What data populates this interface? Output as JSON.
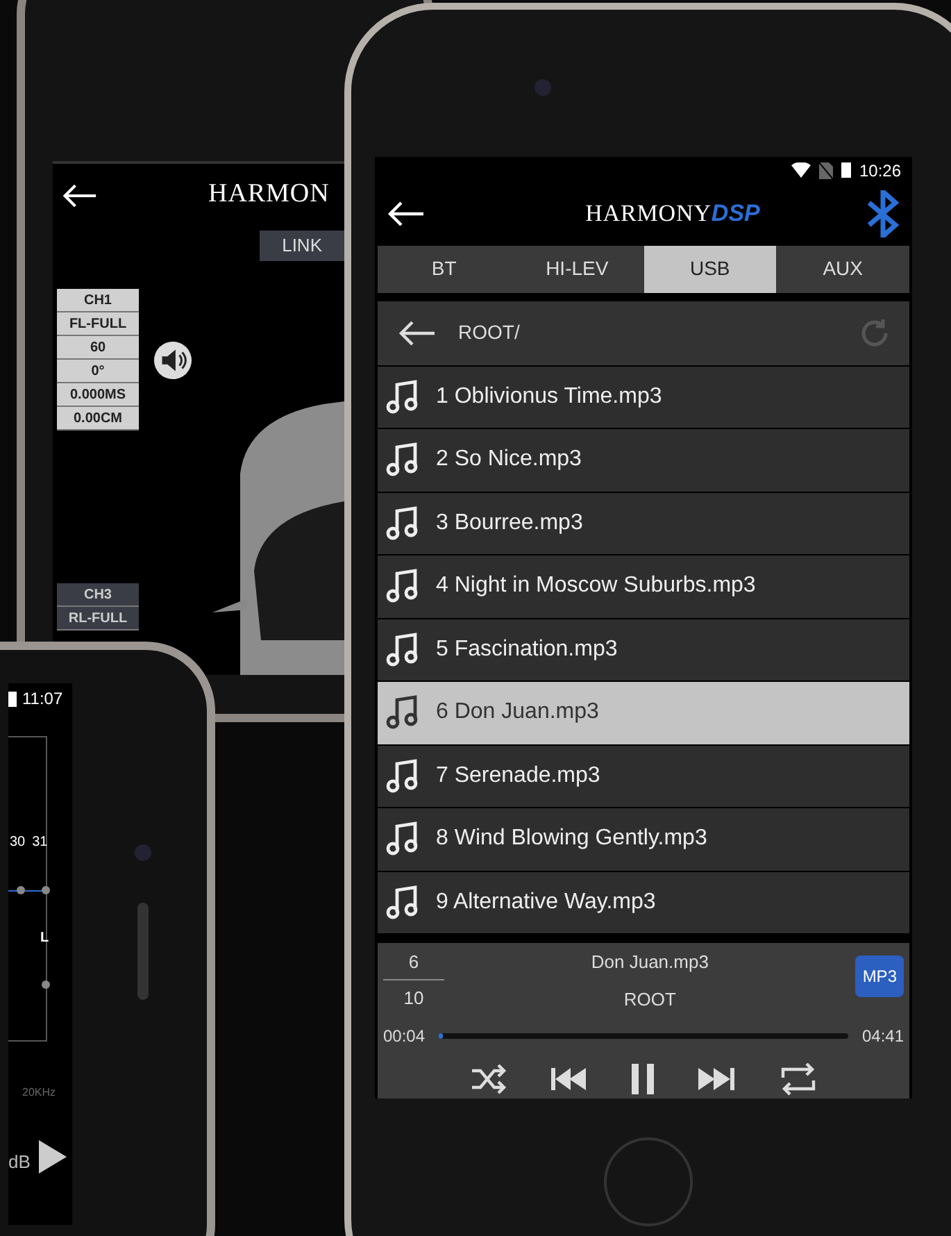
{
  "back_phone": {
    "logo": "HARMON",
    "link_button": "LINK",
    "channels": [
      {
        "lines": [
          "CH1",
          "FL-FULL",
          "60",
          "0°",
          "0.000MS",
          "0.00CM"
        ]
      },
      {
        "lines": [
          "CH3",
          "RL-FULL"
        ]
      }
    ]
  },
  "side_phone": {
    "time": "11:07",
    "eq_labels": [
      "30",
      "31",
      "L"
    ],
    "freq_label": "20KHz",
    "gain_label": "dB"
  },
  "main_phone": {
    "status_bar": {
      "time": "10:26"
    },
    "header": {
      "logo": "HARMONY",
      "logo_accent": "DSP"
    },
    "tabs": [
      {
        "label": "BT",
        "selected": false
      },
      {
        "label": "HI-LEV",
        "selected": false
      },
      {
        "label": "USB",
        "selected": true
      },
      {
        "label": "AUX",
        "selected": false
      }
    ],
    "path": "ROOT/",
    "tracks": [
      {
        "name": "1 Oblivionus Time.mp3",
        "selected": false
      },
      {
        "name": "2 So Nice.mp3",
        "selected": false
      },
      {
        "name": "3 Bourree.mp3",
        "selected": false
      },
      {
        "name": "4 Night in Moscow Suburbs.mp3",
        "selected": false
      },
      {
        "name": "5 Fascination.mp3",
        "selected": false
      },
      {
        "name": "6 Don Juan.mp3",
        "selected": true
      },
      {
        "name": "7 Serenade.mp3",
        "selected": false
      },
      {
        "name": "8 Wind Blowing Gently.mp3",
        "selected": false
      },
      {
        "name": "9 Alternative Way.mp3",
        "selected": false
      }
    ],
    "player": {
      "track_index": "6",
      "track_total": "10",
      "title": "Don Juan.mp3",
      "folder": "ROOT",
      "format": "MP3",
      "elapsed": "00:04",
      "duration": "04:41",
      "level": 0.01
    }
  }
}
